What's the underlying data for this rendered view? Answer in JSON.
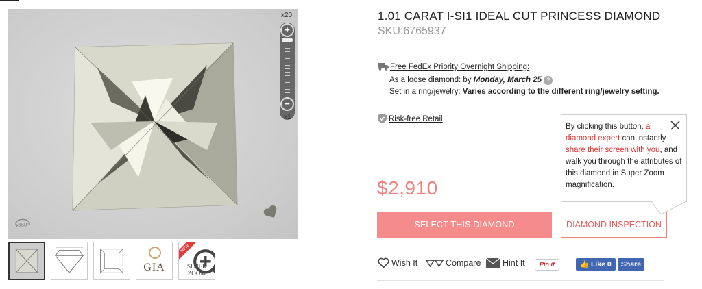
{
  "viewer": {
    "zoom_max_label": "x20",
    "zoom_min_label": "x1",
    "zoom_in_symbol": "+",
    "zoom_out_symbol": "−",
    "rotate_icon": "360-view-icon",
    "rotate_label": "360°",
    "favorite_icon": "heart-icon"
  },
  "thumbnails": [
    {
      "kind": "photo",
      "active": true
    },
    {
      "kind": "side-profile-diagram"
    },
    {
      "kind": "top-view-diagram"
    },
    {
      "kind": "gia-certificate",
      "label": "GIA"
    },
    {
      "kind": "super-zoom",
      "label_line1": "SUPER",
      "label_line2": "ZOOM",
      "badge": "NEW"
    }
  ],
  "product": {
    "title": "1.01 CARAT I-SI1 IDEAL CUT PRINCESS DIAMOND",
    "sku": "SKU:6765937",
    "price": "$2,910",
    "price_color": "#f07f7f"
  },
  "shipping": {
    "icon": "truck-icon",
    "link_label": "Free FedEx Priority Overnight Shipping:",
    "loose_prefix": "As a loose diamond: by ",
    "loose_date": "Monday, March 25",
    "ring_prefix": "Set in a ring/jewelry: ",
    "ring_value": "Varies according to the different ring/jewelry setting."
  },
  "risk_free": {
    "icon": "shield-icon",
    "label": "Risk-free Retail"
  },
  "tooltip": {
    "part1": "By clicking this button, ",
    "part2_red": "a diamond expert",
    "part3": " can instantly ",
    "part4_red": "share their screen with you",
    "part5": ", and walk you through the attributes of this diamond in Super Zoom magnification.",
    "close_icon": "close-icon"
  },
  "buttons": {
    "select": "SELECT THIS DIAMOND",
    "inspect": "DIAMOND INSPECTION",
    "select_color": "#f58b8b"
  },
  "actions": {
    "wish": "Wish It",
    "compare": "Compare",
    "hint": "Hint It",
    "pinit": "Pin it",
    "fb_like": "Like 0",
    "fb_share": "Share"
  }
}
